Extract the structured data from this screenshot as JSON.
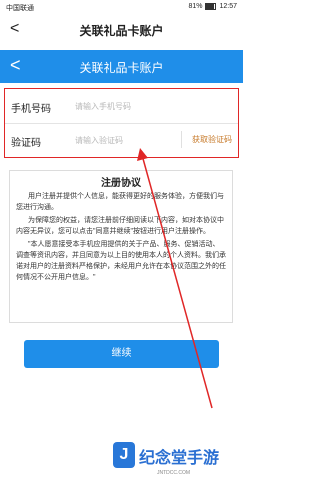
{
  "status": {
    "carrier": "中国联通",
    "battery": "81%",
    "time": "12:57"
  },
  "titlebar": {
    "back": "<",
    "title": "关联礼品卡账户"
  },
  "header": {
    "back": "<",
    "title": "关联礼品卡账户"
  },
  "form": {
    "phone_label": "手机号码",
    "phone_placeholder": "请输入手机号码",
    "code_label": "验证码",
    "code_placeholder": "请输入验证码",
    "get_code": "获取验证码"
  },
  "agreement": {
    "title": "注册协议",
    "p1": "用户注册并提供个人信息，能获得更好的服务体验，方便我们与您进行沟通。",
    "p2": "为保障您的权益，请您注册前仔细阅读以下内容，如对本协议中内容无异议，您可以点击\"同意并继续\"按钮进行用户注册操作。",
    "p3": "\"本人愿意接受本手机应用提供的关于产品、服务、促销活动、调查等资讯内容，并且同意为以上目的使用本人的个人资料。我们承诺对用户的注册资料严格保护，未经用户允许在本协议范围之外的任何情况不公开用户信息。\""
  },
  "continue_label": "继续",
  "watermark": {
    "logo": "J",
    "name": "纪念堂手游",
    "site": "JNTDCC.COM"
  },
  "colors": {
    "primary": "#1f8ee9",
    "highlight": "#e02727",
    "code_link": "#c77a2a"
  }
}
